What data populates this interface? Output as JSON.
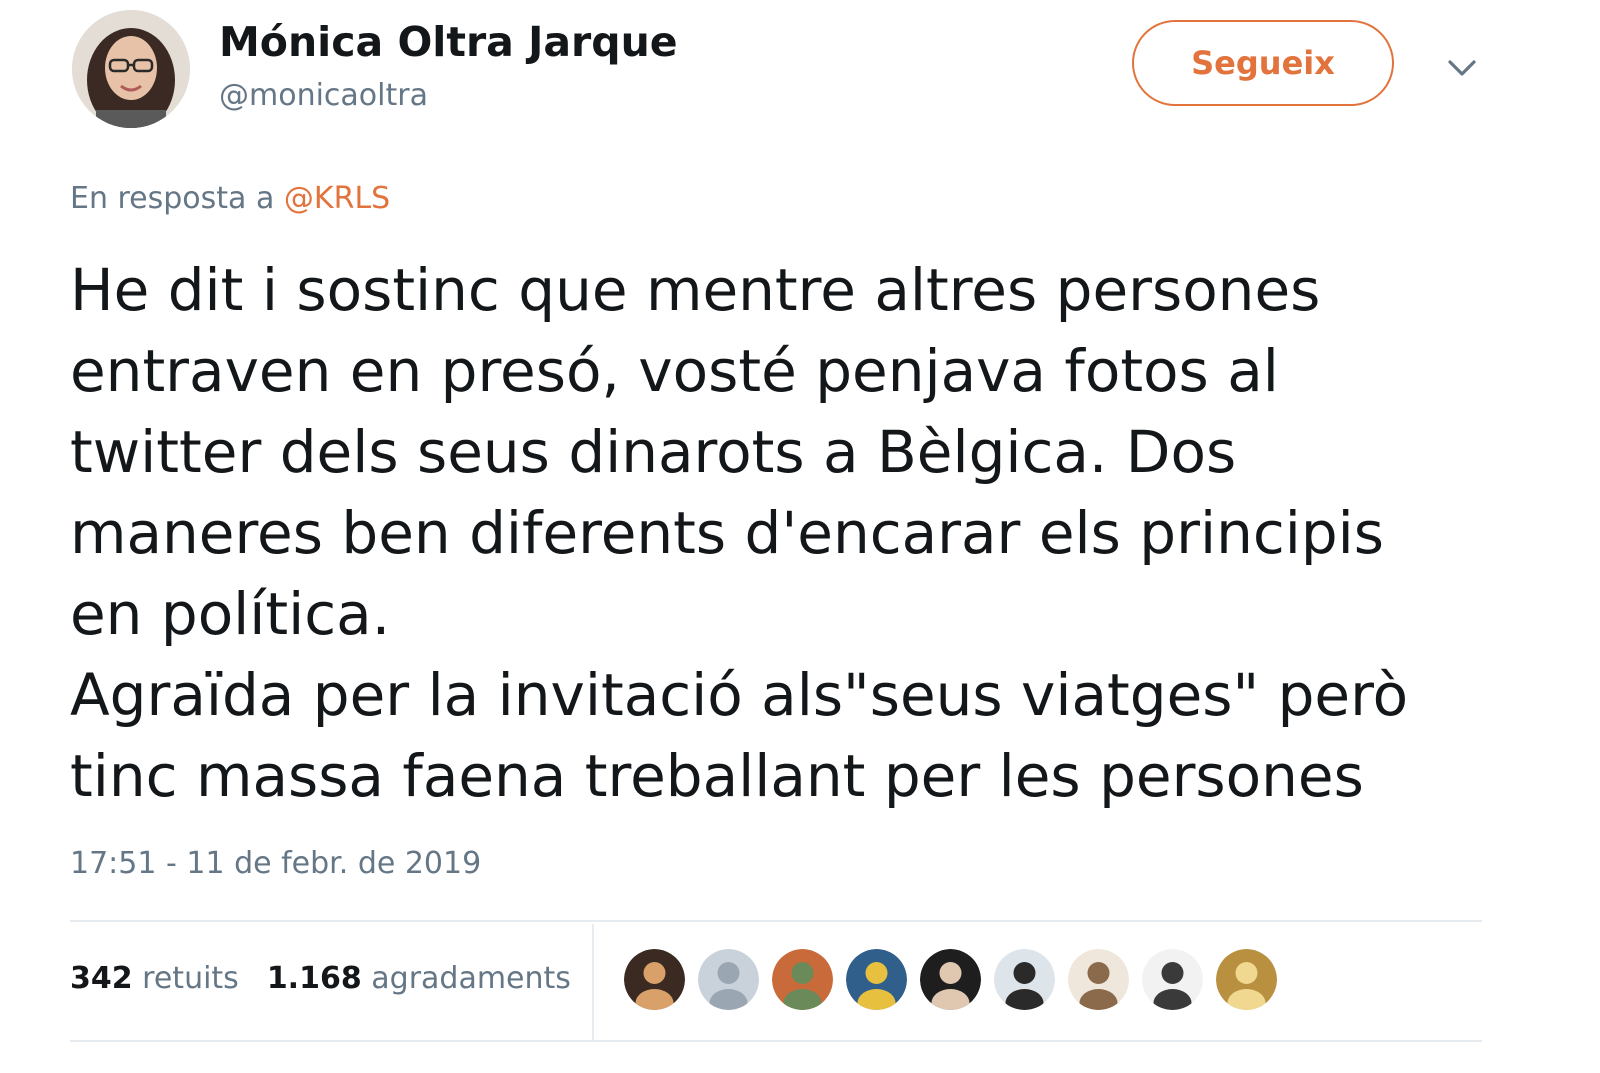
{
  "author": {
    "name": "Mónica Oltra Jarque",
    "handle": "@monicaoltra",
    "avatar_icon": "profile-photo"
  },
  "follow_button": {
    "label": "Segueix",
    "color": "#e2733c"
  },
  "menu_caret_icon": "chevron-down-icon",
  "reply": {
    "prefix": "En resposta a",
    "mention": "@KRLS"
  },
  "tweet": {
    "lines": [
      "He dit i sostinc que mentre altres persones",
      "entraven en presó, vosté penjava fotos al",
      "twitter dels seus dinarots a Bèlgica. Dos",
      "maneres ben diferents d'encarar els principis",
      "en política.",
      "Agraïda per la invitació als\"seus viatges\" però",
      "tinc massa faena treballant per les persones"
    ]
  },
  "timestamp": "17:51 - 11 de febr. de 2019",
  "stats": {
    "retweets_count": "342",
    "retweets_label": "retuits",
    "likes_count": "1.168",
    "likes_label": "agradaments"
  },
  "likers": [
    {
      "name": "liker-avatar-1",
      "bg": "#3a2a22",
      "fg": "#d9a06a"
    },
    {
      "name": "liker-avatar-2",
      "bg": "#c9d2da",
      "fg": "#9aa7b3"
    },
    {
      "name": "liker-avatar-3",
      "bg": "#c96a3a",
      "fg": "#6b8a5a"
    },
    {
      "name": "liker-avatar-4",
      "bg": "#2f5f8a",
      "fg": "#e8c040"
    },
    {
      "name": "liker-avatar-5",
      "bg": "#1e1e1e",
      "fg": "#e0c8b0"
    },
    {
      "name": "liker-avatar-6",
      "bg": "#dde4ea",
      "fg": "#2a2a2a"
    },
    {
      "name": "liker-avatar-7",
      "bg": "#efe6dc",
      "fg": "#8a6a4a"
    },
    {
      "name": "liker-avatar-8",
      "bg": "#f2f2f2",
      "fg": "#3a3a3a"
    },
    {
      "name": "liker-avatar-9",
      "bg": "#b89040",
      "fg": "#f0d890"
    }
  ]
}
